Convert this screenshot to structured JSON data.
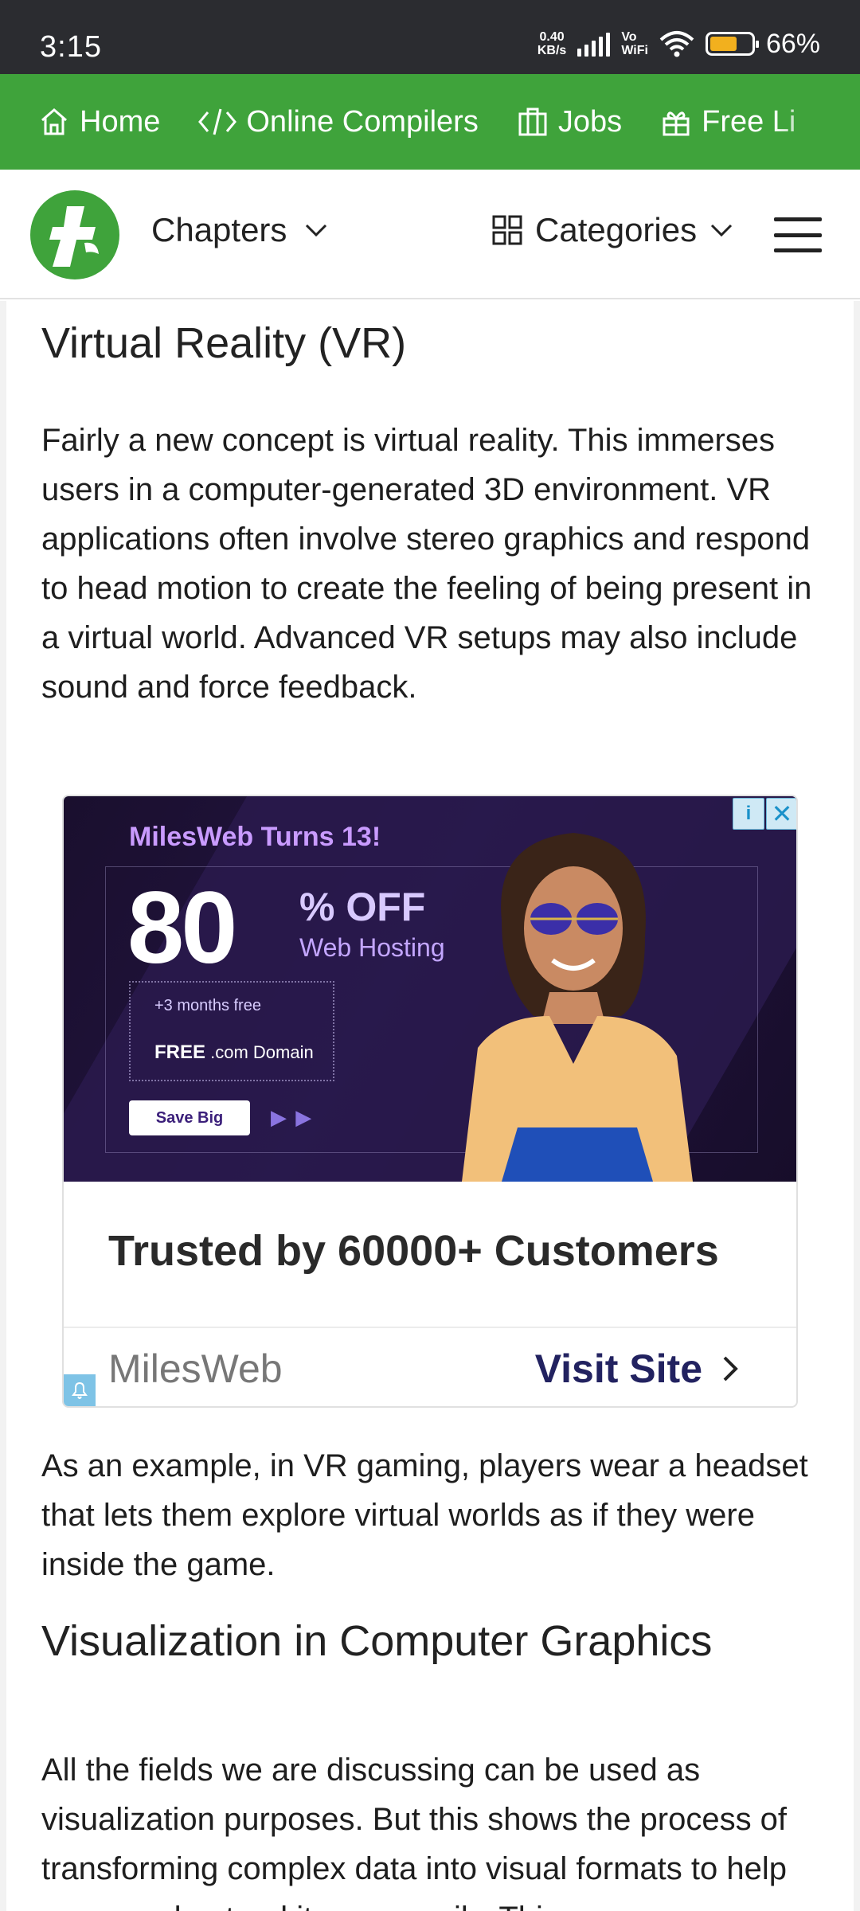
{
  "status_bar": {
    "time": "3:15",
    "net_speed_value": "0.40",
    "net_speed_unit": "KB/s",
    "vo_wifi_top": "Vo",
    "vo_wifi_bottom": "WiFi",
    "battery": "66%",
    "battery_level": 0.66
  },
  "top_nav": {
    "items": [
      {
        "label": "Home",
        "icon": "home-icon"
      },
      {
        "label": "Online Compilers",
        "icon": "code-icon"
      },
      {
        "label": "Jobs",
        "icon": "briefcase-icon"
      },
      {
        "label": "Free Li",
        "icon": "gift-icon"
      }
    ],
    "background_color": "#3fa33b"
  },
  "header": {
    "logo_icon": "tutorialspoint-logo",
    "chapters": "Chapters",
    "categories": "Categories",
    "menu_icon": "hamburger-icon",
    "brand_color": "#3fa33b"
  },
  "content": {
    "heading_vr": "Virtual Reality (VR)",
    "para_vr": "Fairly a new concept is virtual reality. This immerses users in a computer-generated 3D environment. VR applications often involve stereo graphics and respond to head motion to create the feeling of being present in a virtual world. Advanced VR setups may also include sound and force feedback.",
    "para_example": "As an example, in VR gaming, players wear a headset that lets them explore virtual worlds as if they were inside the game.",
    "heading_vis": "Visualization in Computer Graphics",
    "para_vis": "All the fields we are discussing can be used as visualization purposes. But this shows the process of transforming complex data into visual formats to help users understand it more easily. This can"
  },
  "ad": {
    "title": "MilesWeb Turns 13!",
    "big_number": "80",
    "off": "% OFF",
    "web_hosting": "Web Hosting",
    "months_free": "+3 months free",
    "domain_bold": "FREE",
    "domain_rest": " .com Domain",
    "button": "Save Big",
    "headline": "Trusted by 60000+ Customers",
    "brand": "MilesWeb",
    "visit": "Visit Site"
  }
}
